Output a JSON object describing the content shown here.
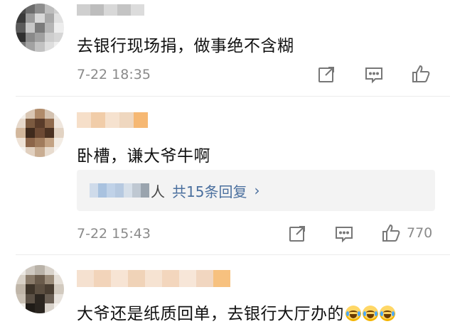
{
  "comments": [
    {
      "text": "去银行现场捐，做事绝不含糊",
      "time": "7-22 18:35",
      "like_count": ""
    },
    {
      "text": "卧槽，谦大爷牛啊",
      "time": "7-22 15:43",
      "like_count": "770",
      "replies": {
        "name_suffix": "人",
        "count_label": "共15条回复",
        "chevron": "›"
      }
    },
    {
      "text": "大爷还是纸质回单，去银行大厅办的"
    }
  ],
  "icons": {
    "share": "share-icon",
    "comment": "comment-icon",
    "like": "like-icon",
    "emoji": "laugh-cry-emoji"
  }
}
